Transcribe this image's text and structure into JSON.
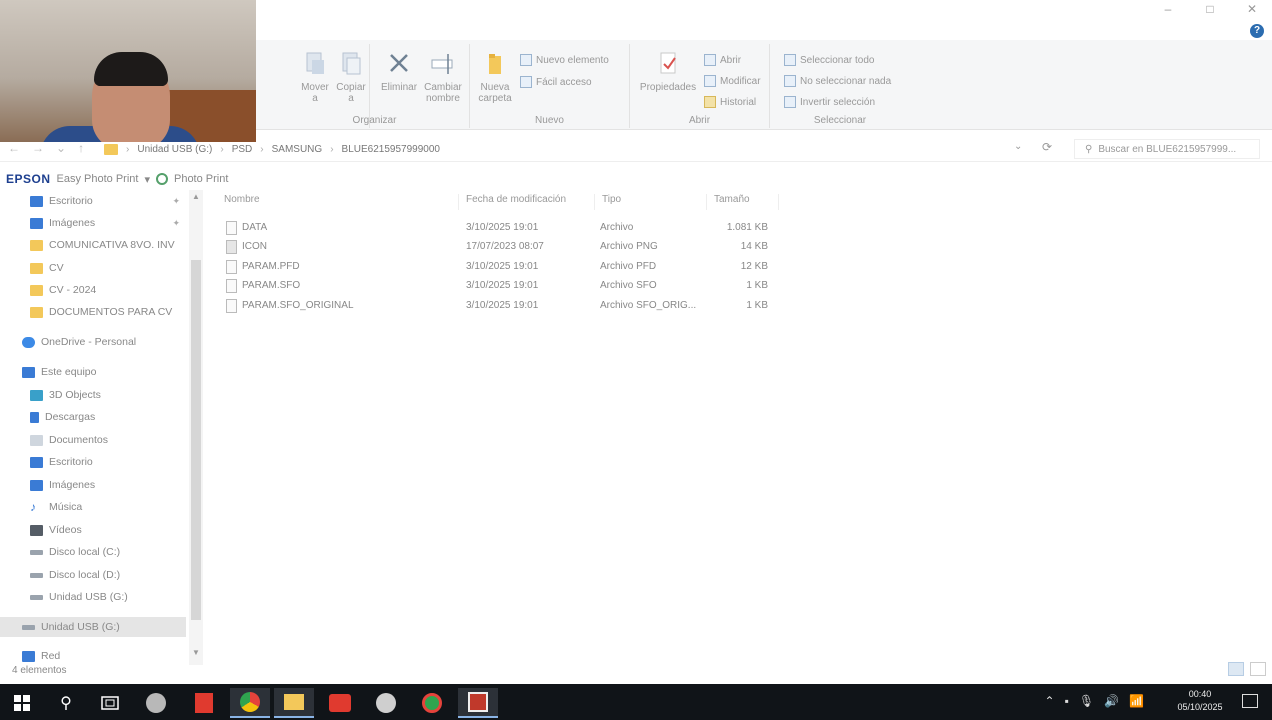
{
  "ribbon": {
    "organize": {
      "label": "Organizar",
      "move_to": "Mover\na",
      "copy_to": "Copiar\na",
      "delete": "Eliminar",
      "rename": "Cambiar\nnombre"
    },
    "new": {
      "label": "Nuevo",
      "new_folder": "Nueva\ncarpeta",
      "new_item": "Nuevo elemento",
      "easy_access": "Fácil acceso"
    },
    "open": {
      "label": "Abrir",
      "properties": "Propiedades",
      "open": "Abrir",
      "edit": "Modificar",
      "history": "Historial"
    },
    "select": {
      "label": "Seleccionar",
      "select_all": "Seleccionar todo",
      "select_none": "No seleccionar nada",
      "invert": "Invertir selección"
    }
  },
  "address": {
    "crumbs": [
      "Unidad USB (G:)",
      "PSD",
      "SAMSUNG",
      "BLUE6215957999000"
    ],
    "search_placeholder": "Buscar en BLUE6215957999..."
  },
  "epson": {
    "logo": "EPSON",
    "app": "Easy Photo Print",
    "photo": "Photo Print"
  },
  "sidebar": {
    "items": [
      {
        "label": "Escritorio",
        "color": "#3a7bd5"
      },
      {
        "label": "Imágenes",
        "color": "#3a7bd5"
      },
      {
        "label": "COMUNICATIVA 8VO. INV",
        "color": "#f3c85a"
      },
      {
        "label": "CV",
        "color": "#f3c85a"
      },
      {
        "label": "CV - 2024",
        "color": "#f3c85a"
      },
      {
        "label": "DOCUMENTOS PARA CV",
        "color": "#f3c85a"
      },
      {
        "label": "OneDrive - Personal",
        "color": "#3c8ae6"
      },
      {
        "label": "Este equipo",
        "color": "#3a7bd5"
      },
      {
        "label": "3D Objects",
        "color": "#39a0c9"
      },
      {
        "label": "Descargas",
        "color": "#3a7bd5"
      },
      {
        "label": "Documentos",
        "color": "#cfd6de"
      },
      {
        "label": "Escritorio",
        "color": "#3a7bd5"
      },
      {
        "label": "Imágenes",
        "color": "#3a7bd5"
      },
      {
        "label": "Música",
        "color": "#3a7bd5"
      },
      {
        "label": "Vídeos",
        "color": "#555d66"
      },
      {
        "label": "Disco local (C:)",
        "color": "#9aa3ad"
      },
      {
        "label": "Disco local (D:)",
        "color": "#9aa3ad"
      },
      {
        "label": "Unidad USB (G:)",
        "color": "#9aa3ad"
      },
      {
        "label": "Unidad USB (G:)",
        "color": "#9aa3ad"
      },
      {
        "label": "Red",
        "color": "#3a7bd5"
      }
    ],
    "footer": "4 elementos"
  },
  "files": {
    "columns": [
      "Nombre",
      "Fecha de modificación",
      "Tipo",
      "Tamaño"
    ],
    "rows": [
      {
        "name": "DATA",
        "date": "3/10/2025 19:01",
        "type": "Archivo",
        "size": "1.081 KB"
      },
      {
        "name": "ICON",
        "date": "17/07/2023 08:07",
        "type": "Archivo PNG",
        "size": "14 KB"
      },
      {
        "name": "PARAM.PFD",
        "date": "3/10/2025 19:01",
        "type": "Archivo PFD",
        "size": "12 KB"
      },
      {
        "name": "PARAM.SFO",
        "date": "3/10/2025 19:01",
        "type": "Archivo SFO",
        "size": "1 KB"
      },
      {
        "name": "PARAM.SFO_ORIGINAL",
        "date": "3/10/2025 19:01",
        "type": "Archivo SFO_ORIG...",
        "size": "1 KB"
      }
    ]
  },
  "taskbar": {
    "time": "00:40",
    "date": "05/10/2025"
  }
}
